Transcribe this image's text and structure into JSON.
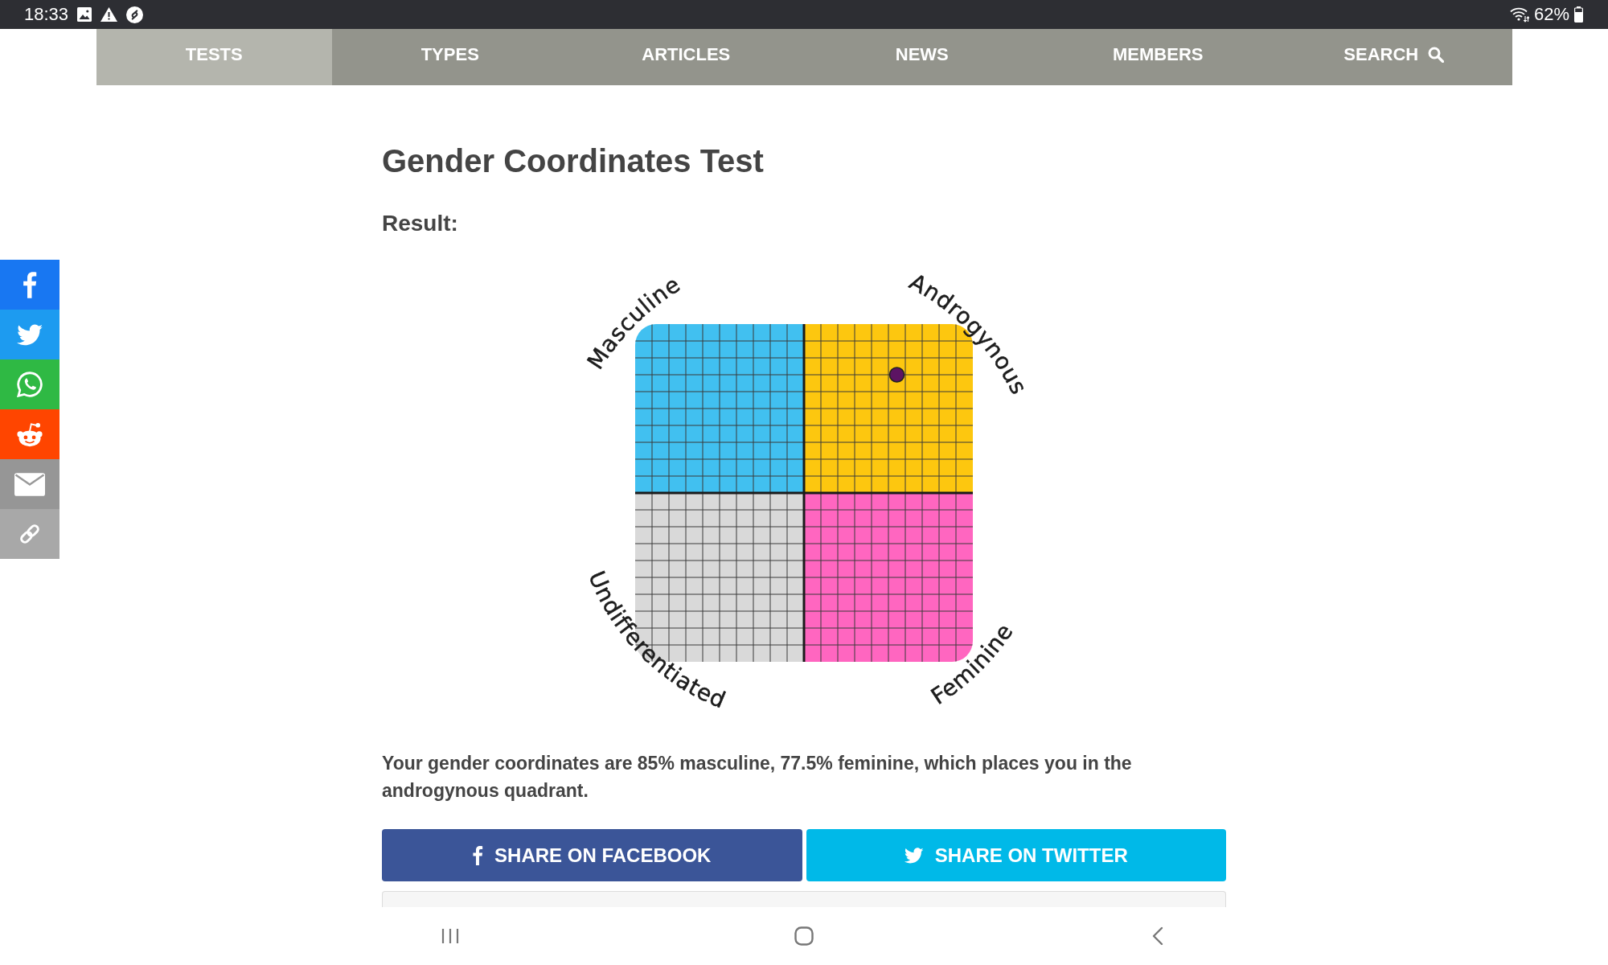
{
  "status_bar": {
    "time": "18:33",
    "battery": "62%"
  },
  "nav": {
    "items": [
      {
        "label": "TESTS",
        "kind": "link",
        "selected": true
      },
      {
        "label": "TYPES",
        "kind": "link",
        "selected": false
      },
      {
        "label": "ARTICLES",
        "kind": "link",
        "selected": false
      },
      {
        "label": "NEWS",
        "kind": "link",
        "selected": false
      },
      {
        "label": "MEMBERS",
        "kind": "link",
        "selected": false
      },
      {
        "label": "SEARCH",
        "kind": "search",
        "selected": false
      }
    ]
  },
  "share_sidebar": [
    {
      "kind": "facebook",
      "color": "#1877f2"
    },
    {
      "kind": "twitter",
      "color": "#1d9bf0"
    },
    {
      "kind": "whatsapp",
      "color": "#2fb944"
    },
    {
      "kind": "reddit",
      "color": "#ff4500"
    },
    {
      "kind": "email",
      "color": "#969696"
    },
    {
      "kind": "link",
      "color": "#a8a8a8"
    }
  ],
  "title": "Gender Coordinates Test",
  "result": {
    "heading": "Result:",
    "chart": {
      "quadrants": [
        {
          "label": "Masculine",
          "color": "#41c0f0"
        },
        {
          "label": "Androgynous",
          "color": "#fdc70f"
        },
        {
          "label": "Undifferentiated",
          "color": "#d9d9d9"
        },
        {
          "label": "Feminine",
          "color": "#ff66c0"
        }
      ],
      "marker": {
        "x": {
          "level": 0.775
        },
        "y": {
          "level": 0.85
        }
      }
    },
    "summary": "Your gender coordinates are 85% masculine, 77.5% feminine, which places you in the androgynous quadrant."
  },
  "share_buttons": [
    {
      "kind": "facebook",
      "label": "SHARE ON FACEBOOK",
      "color": "#3b5598"
    },
    {
      "kind": "twitter",
      "label": "SHARE ON TWITTER",
      "color": "#00b9e8"
    }
  ]
}
